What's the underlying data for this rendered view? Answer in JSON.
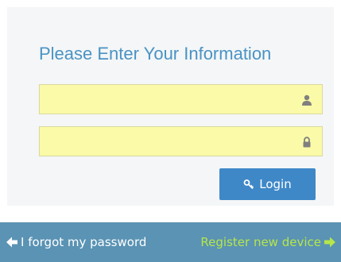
{
  "form": {
    "title": "Please Enter Your Information",
    "username": {
      "value": "",
      "placeholder": "",
      "icon": "user-icon"
    },
    "password": {
      "value": "",
      "placeholder": "",
      "icon": "lock-icon"
    },
    "login_label": "Login",
    "login_icon": "key-icon"
  },
  "footer": {
    "forgot_label": "I forgot my password",
    "forgot_icon": "arrow-left-icon",
    "register_label": "Register new device",
    "register_icon": "arrow-right-icon"
  },
  "colors": {
    "title": "#4a93c4",
    "field_background": "#fafaa8",
    "login_button": "#3f88c8",
    "footer_background": "#5a93b4",
    "forgot_link": "#ffffff",
    "register_link": "#b5e64a"
  }
}
